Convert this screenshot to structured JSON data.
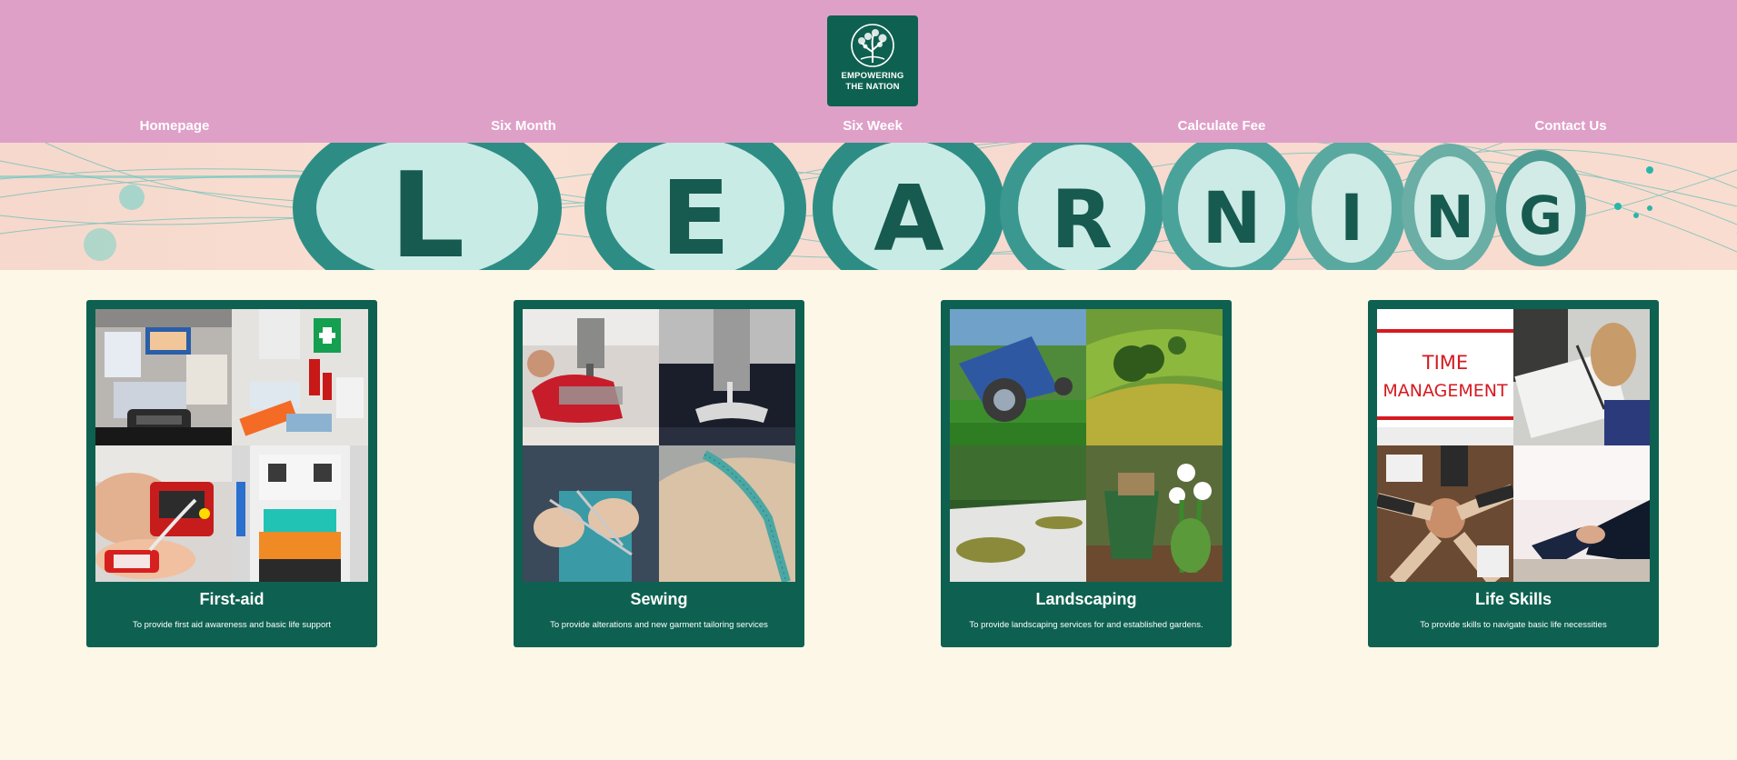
{
  "logo": {
    "icon": "tree-icon",
    "line1": "EMPOWERING",
    "line2": "THE NATION"
  },
  "nav": {
    "items": [
      {
        "label": "Homepage"
      },
      {
        "label": "Six Month"
      },
      {
        "label": "Six Week"
      },
      {
        "label": "Calculate Fee"
      },
      {
        "label": "Contact Us"
      }
    ]
  },
  "banner": {
    "word": "LEARNING",
    "letters": [
      "L",
      "E",
      "A",
      "R",
      "N",
      "I",
      "N",
      "G"
    ]
  },
  "cards": [
    {
      "title": "First-aid",
      "description": "To provide first aid awareness and basic life support"
    },
    {
      "title": "Sewing",
      "description": "To provide alterations and new garment tailoring services"
    },
    {
      "title": "Landscaping",
      "description": "To provide landscaping services for and established gardens."
    },
    {
      "title": "Life Skills",
      "description": "To provide skills to navigate basic life necessities"
    }
  ],
  "collage_tiles": {
    "first_aid": [
      "first-aid kit",
      "medical supplies",
      "cpr mannequin",
      "ambulance interior"
    ],
    "sewing": [
      "sewing machine red fabric",
      "sewing machine dark fabric",
      "knitting",
      "measuring tape"
    ],
    "landscaping": [
      "lawn mower",
      "green hills",
      "zen garden",
      "bucket and tulips"
    ],
    "life_skills": [
      "time management sign",
      "note taking",
      "teamwork hands",
      "handshake"
    ]
  },
  "time_management_text": "TIME MANAGEMENT",
  "colors": {
    "header_bg": "#dfa0c8",
    "page_bg": "#fdf7e8",
    "accent_green": "#0e6150",
    "text_light": "#ffffff"
  }
}
